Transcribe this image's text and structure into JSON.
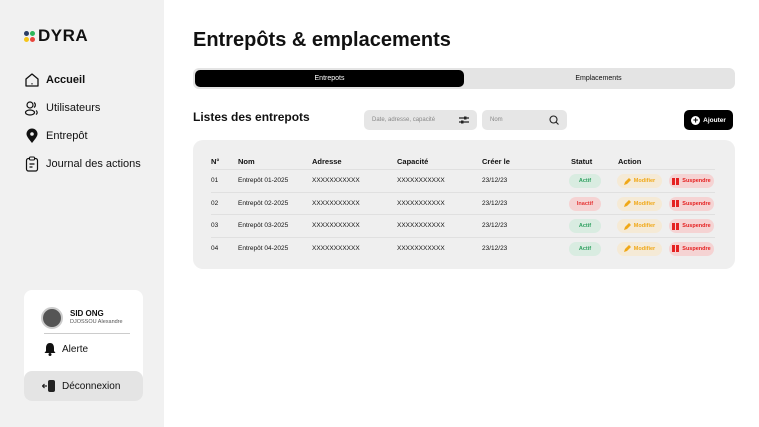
{
  "brand": {
    "name": "DYRA",
    "colors": [
      "#2c3e66",
      "#2cb55a",
      "#f5c518",
      "#e8453c"
    ]
  },
  "nav": [
    {
      "label": "Accueil",
      "icon": "home-icon"
    },
    {
      "label": "Utilisateurs",
      "icon": "users-icon"
    },
    {
      "label": "Entrepôt",
      "icon": "location-pin-icon"
    },
    {
      "label": "Journal des actions",
      "icon": "clipboard-icon"
    }
  ],
  "user": {
    "name": "SID ONG",
    "sub": "DJOSSOU Alexandre",
    "alert": "Alerte",
    "logout": "Déconnexion"
  },
  "page": {
    "title": "Entrepôts & emplacements",
    "tabs": [
      "Entrepots",
      "Emplacements"
    ],
    "list_title": "Listes des entrepots",
    "filter_placeholder": "Date, adresse, capacité",
    "search_placeholder": "Nom",
    "add_label": "Ajouter"
  },
  "table": {
    "headers": [
      "N°",
      "Nom",
      "Adresse",
      "Capacité",
      "Créer le",
      "Statut",
      "Action"
    ],
    "rows": [
      {
        "n": "01",
        "nom": "Entrepôt 01-2025",
        "adresse": "XXXXXXXXXXX",
        "capacite": "XXXXXXXXXXX",
        "date": "23/12/23",
        "statut": "Actif"
      },
      {
        "n": "02",
        "nom": "Entrepôt 02-2025",
        "adresse": "XXXXXXXXXXX",
        "capacite": "XXXXXXXXXXX",
        "date": "23/12/23",
        "statut": "Inactif"
      },
      {
        "n": "03",
        "nom": "Entrepôt 03-2025",
        "adresse": "XXXXXXXXXXX",
        "capacite": "XXXXXXXXXXX",
        "date": "23/12/23",
        "statut": "Actif"
      },
      {
        "n": "04",
        "nom": "Entrepôt 04-2025",
        "adresse": "XXXXXXXXXXX",
        "capacite": "XXXXXXXXXXX",
        "date": "23/12/23",
        "statut": "Actif"
      }
    ],
    "modify_label": "Modifier",
    "suspend_label": "Suspendre"
  }
}
